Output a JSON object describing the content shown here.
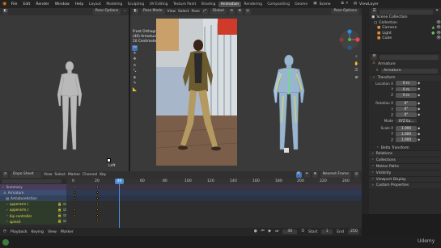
{
  "menubar": {
    "menus": [
      "File",
      "Edit",
      "Render",
      "Window",
      "Help"
    ]
  },
  "workspaces": {
    "tabs": [
      "Layout",
      "Modeling",
      "Sculpting",
      "UV Editing",
      "Texture Paint",
      "Shading",
      "Animation",
      "Rendering",
      "Compositing",
      "Geome"
    ],
    "active": "Animation"
  },
  "scene": {
    "name": "Scene",
    "view_layer": "ViewLayer"
  },
  "left_viewport": {
    "mode": "Pose Options",
    "label": "Left"
  },
  "main_viewport": {
    "mode": "Pose Mode",
    "menus": [
      "View",
      "Select",
      "Pose"
    ],
    "orientation": "Global",
    "options": "Pose Options",
    "overlay_lines": [
      "Front Orthographic",
      "(40) Armature : upperarm.l",
      "10 Centimeters"
    ]
  },
  "outliner": {
    "title": "Scene Collection",
    "items": [
      {
        "label": "Collection"
      },
      {
        "label": "Camera"
      },
      {
        "label": "Light"
      },
      {
        "label": "Cube"
      }
    ]
  },
  "properties": {
    "object": "Armature",
    "data": "Armature",
    "transform_title": "Transform",
    "location": [
      {
        "axis": "Location X",
        "value": "0 m"
      },
      {
        "axis": "Y",
        "value": "0 m"
      },
      {
        "axis": "Z",
        "value": "0 m"
      }
    ],
    "rotation": [
      {
        "axis": "Rotation X",
        "value": "0°"
      },
      {
        "axis": "Y",
        "value": "0°"
      },
      {
        "axis": "Z",
        "value": "0°"
      }
    ],
    "mode_label": "Mode",
    "mode_value": "XYZ Eu...",
    "scale": [
      {
        "axis": "Scale X",
        "value": "1.000"
      },
      {
        "axis": "Y",
        "value": "1.000"
      },
      {
        "axis": "Z",
        "value": "1.000"
      }
    ],
    "panels": [
      "Delta Transform",
      "Relations",
      "Collections",
      "Motion Paths",
      "Visibility",
      "Viewport Display",
      "Custom Properties"
    ]
  },
  "dope_sheet": {
    "editor": "Dope Sheet",
    "menus": [
      "View",
      "Select",
      "Marker",
      "Channel",
      "Key"
    ],
    "snap": "Nearest Frame",
    "current_frame": "40",
    "ticks": [
      "0",
      "20",
      "40",
      "60",
      "80",
      "100",
      "120",
      "140",
      "160",
      "180",
      "200",
      "220",
      "240"
    ],
    "channels": [
      {
        "label": "Summary"
      },
      {
        "label": "Armature"
      },
      {
        "label": "ArmatureAction"
      },
      {
        "label": "upperarm.l"
      },
      {
        "label": "upperarm.r"
      },
      {
        "label": "hip controller"
      },
      {
        "label": "spine3"
      }
    ]
  },
  "playback": {
    "menus": [
      "Playback",
      "Keying",
      "View",
      "Marker"
    ],
    "frame": "40",
    "start_label": "Start",
    "start": "1",
    "end_label": "End",
    "end": "250"
  },
  "watermark": "Udemy"
}
